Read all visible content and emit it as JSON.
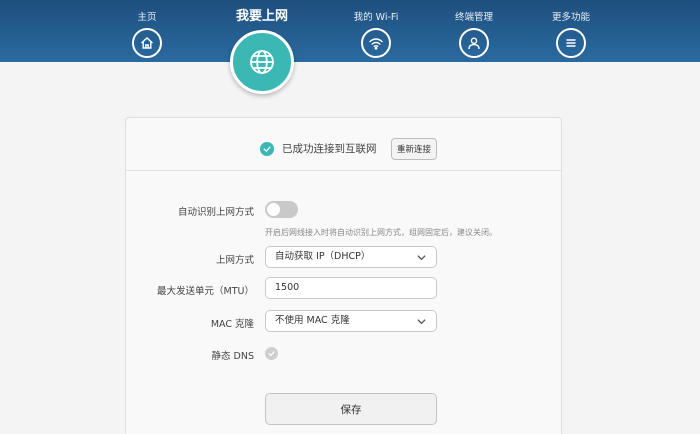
{
  "nav": {
    "home": "主页",
    "internet": "我要上网",
    "wifi": "我的 Wi-Fi",
    "devices": "终端管理",
    "more": "更多功能"
  },
  "status": {
    "text": "已成功连接到互联网",
    "reconnect_label": "重新连接"
  },
  "form": {
    "auto_detect_label": "自动识别上网方式",
    "auto_detect_on": false,
    "auto_detect_hint": "开启后网线接入时将自动识别上网方式，组网固定后，建议关闭。",
    "mode_label": "上网方式",
    "mode_value": "自动获取 IP（DHCP）",
    "mtu_label": "最大发送单元（MTU）",
    "mtu_value": "1500",
    "mac_label": "MAC 克隆",
    "mac_value": "不使用 MAC 克隆",
    "dns_label": "静态 DNS",
    "save_label": "保存"
  },
  "colors": {
    "header": "#2a6aa0",
    "accent": "#3bb7b4"
  }
}
